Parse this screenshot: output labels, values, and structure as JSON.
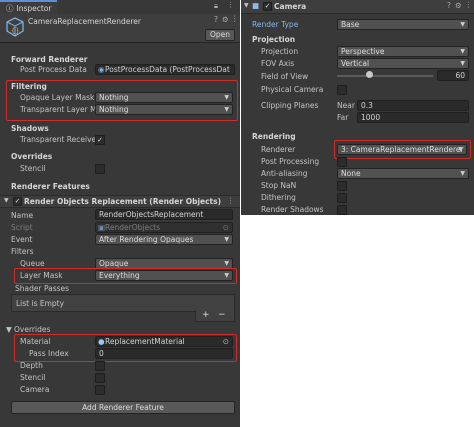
{
  "inspector": {
    "tab_label": "Inspector",
    "asset_name": "CameraReplacementRenderer",
    "open_label": "Open",
    "forward_renderer_heading": "Forward Renderer",
    "post_process_label": "Post Process Data",
    "post_process_value": "PostProcessData (PostProcessDat",
    "filtering_heading": "Filtering",
    "opaque_mask_label": "Opaque Layer Mask",
    "opaque_mask_value": "Nothing",
    "transparent_mask_label": "Transparent Layer M",
    "transparent_mask_value": "Nothing",
    "shadows_heading": "Shadows",
    "transparent_receive_label": "Transparent Receive",
    "transparent_receive_checked": true,
    "overrides_heading": "Overrides",
    "stencil_label": "Stencil",
    "renderer_features_heading": "Renderer Features",
    "feature_title": "Render Objects Replacement (Render Objects)",
    "name_label": "Name",
    "name_value": "RenderObjectsReplacement",
    "script_label": "Script",
    "script_value": "RenderObjects",
    "event_label": "Event",
    "event_value": "After Rendering Opaques",
    "filters_heading": "Filters",
    "queue_label": "Queue",
    "queue_value": "Opaque",
    "layer_mask_label": "Layer Mask",
    "layer_mask_value": "Everything",
    "shader_passes_label": "Shader Passes",
    "list_empty_label": "List is Empty",
    "plus_label": "+",
    "minus_label": "−",
    "overrides2_heading": "Overrides",
    "material_label": "Material",
    "material_value": "ReplacementMaterial",
    "pass_index_label": "Pass Index",
    "pass_index_value": "0",
    "depth_label": "Depth",
    "stencil2_label": "Stencil",
    "camera_label": "Camera",
    "add_feature_label": "Add Renderer Feature"
  },
  "camera": {
    "title": "Camera",
    "render_type_label": "Render Type",
    "render_type_value": "Base",
    "projection_heading": "Projection",
    "projection_label": "Projection",
    "projection_value": "Perspective",
    "fov_axis_label": "FOV Axis",
    "fov_axis_value": "Vertical",
    "fov_label": "Field of View",
    "fov_value": "60",
    "physical_label": "Physical Camera",
    "clipping_label": "Clipping Planes",
    "near_label": "Near",
    "near_value": "0.3",
    "far_label": "Far",
    "far_value": "1000",
    "rendering_heading": "Rendering",
    "renderer_label": "Renderer",
    "renderer_value": "3: CameraReplacementRenderer",
    "post_processing_label": "Post Processing",
    "anti_aliasing_label": "Anti-aliasing",
    "anti_aliasing_value": "None",
    "stop_nan_label": "Stop NaN",
    "dithering_label": "Dithering",
    "render_shadows_label": "Render Shadows"
  },
  "colors": {
    "panel_bg": "#383838",
    "highlight_red": "#d12c2c",
    "accent_blue": "#5d8fd6"
  },
  "icons": [
    "info-icon",
    "lock-icon",
    "menu-icon",
    "asset-cube-icon",
    "fold-arrow-icon",
    "camera-icon",
    "settings-icon",
    "object-picker-icon"
  ]
}
